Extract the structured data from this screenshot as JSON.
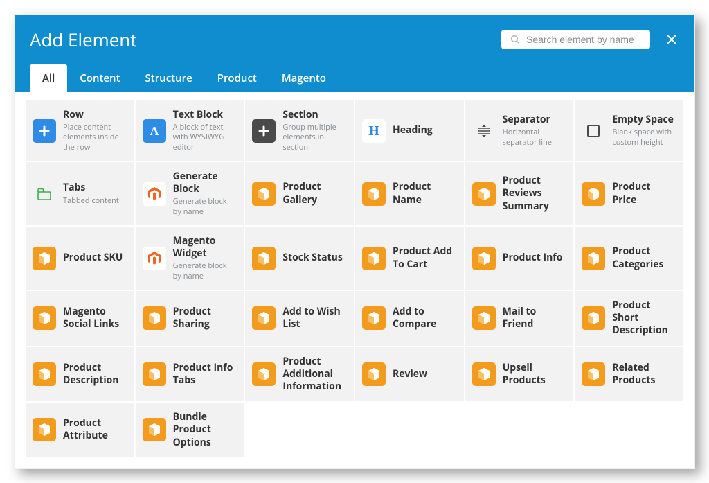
{
  "title": "Add Element",
  "searchPlaceholder": "Search element by name",
  "tabs": [
    {
      "label": "All",
      "active": true
    },
    {
      "label": "Content",
      "active": false
    },
    {
      "label": "Structure",
      "active": false
    },
    {
      "label": "Product",
      "active": false
    },
    {
      "label": "Magento",
      "active": false
    }
  ],
  "tiles": [
    {
      "title": "Row",
      "desc": "Place content elements inside the row",
      "icon": "plus",
      "bg": "ic-blue"
    },
    {
      "title": "Text Block",
      "desc": "A block of text with WYSIWYG editor",
      "icon": "letter",
      "bg": "ic-blue"
    },
    {
      "title": "Section",
      "desc": "Group multiple elements in section",
      "icon": "plus",
      "bg": "ic-dark"
    },
    {
      "title": "Heading",
      "desc": "",
      "icon": "heading",
      "bg": "ic-white"
    },
    {
      "title": "Separator",
      "desc": "Horizontal separator line",
      "icon": "separator",
      "bg": "ic-none"
    },
    {
      "title": "Empty Space",
      "desc": "Blank space with custom height",
      "icon": "square",
      "bg": "ic-none"
    },
    {
      "title": "Tabs",
      "desc": "Tabbed content",
      "icon": "tabs",
      "bg": "ic-none"
    },
    {
      "title": "Generate Block",
      "desc": "Generate block by name",
      "icon": "magento",
      "bg": "ic-white"
    },
    {
      "title": "Product Gallery",
      "desc": "",
      "icon": "box",
      "bg": "ic-orange"
    },
    {
      "title": "Product Name",
      "desc": "",
      "icon": "box",
      "bg": "ic-orange"
    },
    {
      "title": "Product Reviews Summary",
      "desc": "",
      "icon": "box",
      "bg": "ic-orange"
    },
    {
      "title": "Product Price",
      "desc": "",
      "icon": "box",
      "bg": "ic-orange"
    },
    {
      "title": "Product SKU",
      "desc": "",
      "icon": "box",
      "bg": "ic-orange"
    },
    {
      "title": "Magento Widget",
      "desc": "Generate block by name",
      "icon": "magento",
      "bg": "ic-white"
    },
    {
      "title": "Stock Status",
      "desc": "",
      "icon": "box",
      "bg": "ic-orange"
    },
    {
      "title": "Product Add To Cart",
      "desc": "",
      "icon": "box",
      "bg": "ic-orange"
    },
    {
      "title": "Product Info",
      "desc": "",
      "icon": "box",
      "bg": "ic-orange"
    },
    {
      "title": "Product Categories",
      "desc": "",
      "icon": "box",
      "bg": "ic-orange"
    },
    {
      "title": "Magento Social Links",
      "desc": "",
      "icon": "box",
      "bg": "ic-orange"
    },
    {
      "title": "Product Sharing",
      "desc": "",
      "icon": "box",
      "bg": "ic-orange"
    },
    {
      "title": "Add to Wish List",
      "desc": "",
      "icon": "box",
      "bg": "ic-orange"
    },
    {
      "title": "Add to Compare",
      "desc": "",
      "icon": "box",
      "bg": "ic-orange"
    },
    {
      "title": "Mail to Friend",
      "desc": "",
      "icon": "box",
      "bg": "ic-orange"
    },
    {
      "title": "Product Short Description",
      "desc": "",
      "icon": "box",
      "bg": "ic-orange"
    },
    {
      "title": "Product Description",
      "desc": "",
      "icon": "box",
      "bg": "ic-orange"
    },
    {
      "title": "Product Info Tabs",
      "desc": "",
      "icon": "box",
      "bg": "ic-orange"
    },
    {
      "title": "Product Additional Information",
      "desc": "",
      "icon": "box",
      "bg": "ic-orange"
    },
    {
      "title": "Review",
      "desc": "",
      "icon": "box",
      "bg": "ic-orange"
    },
    {
      "title": "Upsell Products",
      "desc": "",
      "icon": "box",
      "bg": "ic-orange"
    },
    {
      "title": "Related Products",
      "desc": "",
      "icon": "box",
      "bg": "ic-orange"
    },
    {
      "title": "Product Attribute",
      "desc": "",
      "icon": "box",
      "bg": "ic-orange"
    },
    {
      "title": "Bundle Product Options",
      "desc": "",
      "icon": "box",
      "bg": "ic-orange"
    }
  ]
}
